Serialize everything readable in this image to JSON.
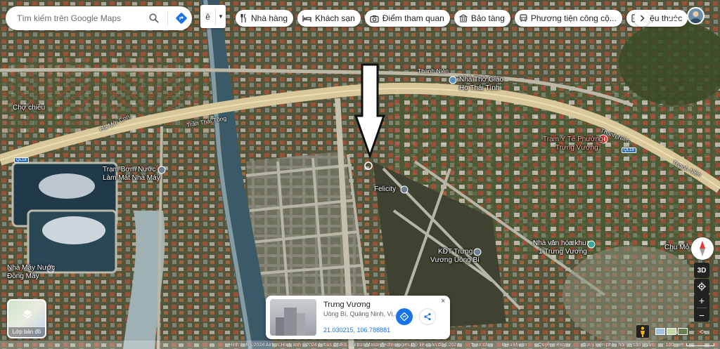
{
  "search": {
    "placeholder": "Tìm kiếm trên Google Maps"
  },
  "language": {
    "glyph": "ê"
  },
  "chips": [
    {
      "label": "Nhà hàng",
      "icon": "restaurant-icon"
    },
    {
      "label": "Khách sạn",
      "icon": "hotel-icon"
    },
    {
      "label": "Điểm tham quan",
      "icon": "camera-icon"
    },
    {
      "label": "Bảo tàng",
      "icon": "museum-icon"
    },
    {
      "label": "Phương tiện công cộ...",
      "icon": "transit-icon"
    },
    {
      "label": "Hiệu thuốc",
      "icon": "pharmacy-icon"
    }
  ],
  "map_labels": {
    "cho_chieu": "Chợ chiều",
    "tram_bom": "Trạm Bơm Nước",
    "tram_bom_2": "Làm Mát Nhà Máy",
    "nha_may_nuoc": "Nhà Máy Nước",
    "nha_may_nuoc_2": "Đồng Mây",
    "nha_tho": "Nhà Thờ Giáo",
    "nha_tho_2": "Họ Thái Tình",
    "tram_y_te": "Trạm Y Tế Phường",
    "tram_y_te_2": "Trưng Vương",
    "felicity": "Felicity",
    "kdt": "KĐT Trưng",
    "kdt_2": "Vương Uông Bí",
    "nha_van_hoa": "Nhà văn hóa khu",
    "nha_van_hoa_2": "1 Trưng Vương",
    "chu_mo": "Chu Mỏ"
  },
  "road_labels": {
    "tran_thai_tong": "Trần Thái Tông",
    "thanh_nien_1": "Thanh Niên",
    "thanh_nien_2": "Thanh Niên",
    "thanh_nien_3": "Thanh Niên",
    "ha_moi": "Hà Mới Con",
    "ql18": "QL18"
  },
  "layer_switch": {
    "label": "Lớp bản đồ"
  },
  "place_card": {
    "title": "Trưng Vương",
    "address": "Uông Bí, Quảng Ninh, Vi...",
    "coordinates": "21.030215, 106.788881",
    "close": "×"
  },
  "controls": {
    "threeD": "3D",
    "zoom_in": "+",
    "zoom_out": "−"
  },
  "footer": {
    "attribution": "Hình ảnh ©2024 Airbus,Hình ảnh ©2024 Airbus,CNES / Airbus,Maxar Technologies,Dữ liệu bản đồ ©2024",
    "global": "Toàn cầu",
    "terms": "Điều khoản",
    "privacy": "Quyền riêng tư",
    "feedback": "Gửi ý kiến phản hồi về sản phẩm",
    "scale": "100 mét"
  },
  "colors": {
    "accent": "#1a73e8",
    "road": "#d8c79a",
    "pin_red": "#e53935"
  }
}
